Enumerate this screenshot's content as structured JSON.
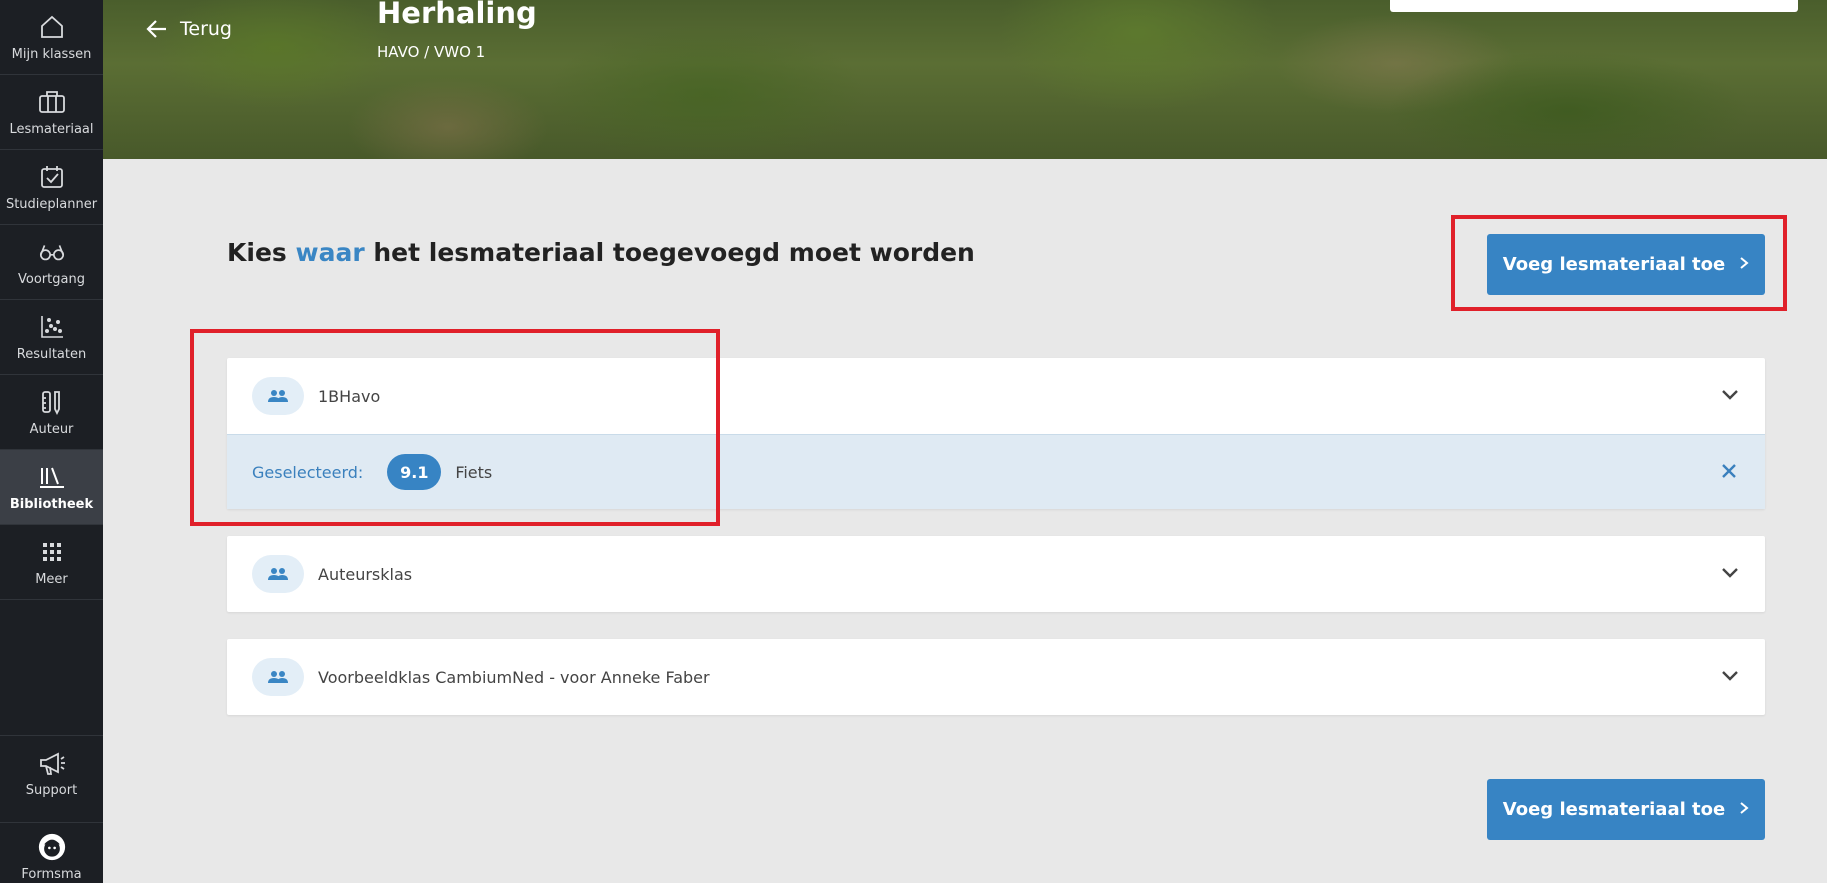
{
  "sidebar": {
    "items": [
      {
        "label": "Mijn klassen",
        "icon": "home-icon"
      },
      {
        "label": "Lesmateriaal",
        "icon": "briefcase-icon"
      },
      {
        "label": "Studieplanner",
        "icon": "calendar-check-icon"
      },
      {
        "label": "Voortgang",
        "icon": "glasses-icon"
      },
      {
        "label": "Resultaten",
        "icon": "scatter-chart-icon"
      },
      {
        "label": "Auteur",
        "icon": "author-tools-icon"
      },
      {
        "label": "Bibliotheek",
        "icon": "library-icon",
        "active": true
      },
      {
        "label": "Meer",
        "icon": "grid-icon"
      }
    ],
    "bottom": [
      {
        "label": "Support",
        "icon": "megaphone-icon"
      },
      {
        "label": "Formsma",
        "icon": "avatar-icon"
      }
    ]
  },
  "header": {
    "back_label": "Terug",
    "title": "Herhaling",
    "subtitle": "HAVO / VWO 1"
  },
  "main": {
    "heading_pre": "Kies ",
    "heading_highlight": "waar",
    "heading_post": " het lesmateriaal toegevoegd moet worden",
    "add_button_label": "Voeg lesmateriaal toe",
    "classes": [
      {
        "name": "1BHavo",
        "expanded": true,
        "selected_label": "Geselecteerd:",
        "selected_badge": "9.1",
        "selected_value": "Fiets"
      },
      {
        "name": "Auteursklas"
      },
      {
        "name": "Voorbeeldklas CambiumNed - voor Anneke Faber"
      }
    ]
  },
  "colors": {
    "accent": "#3784c4",
    "sidebar_bg": "#1c1f24",
    "highlight_box": "#e0202a",
    "selected_bg": "#dfeaf3"
  }
}
